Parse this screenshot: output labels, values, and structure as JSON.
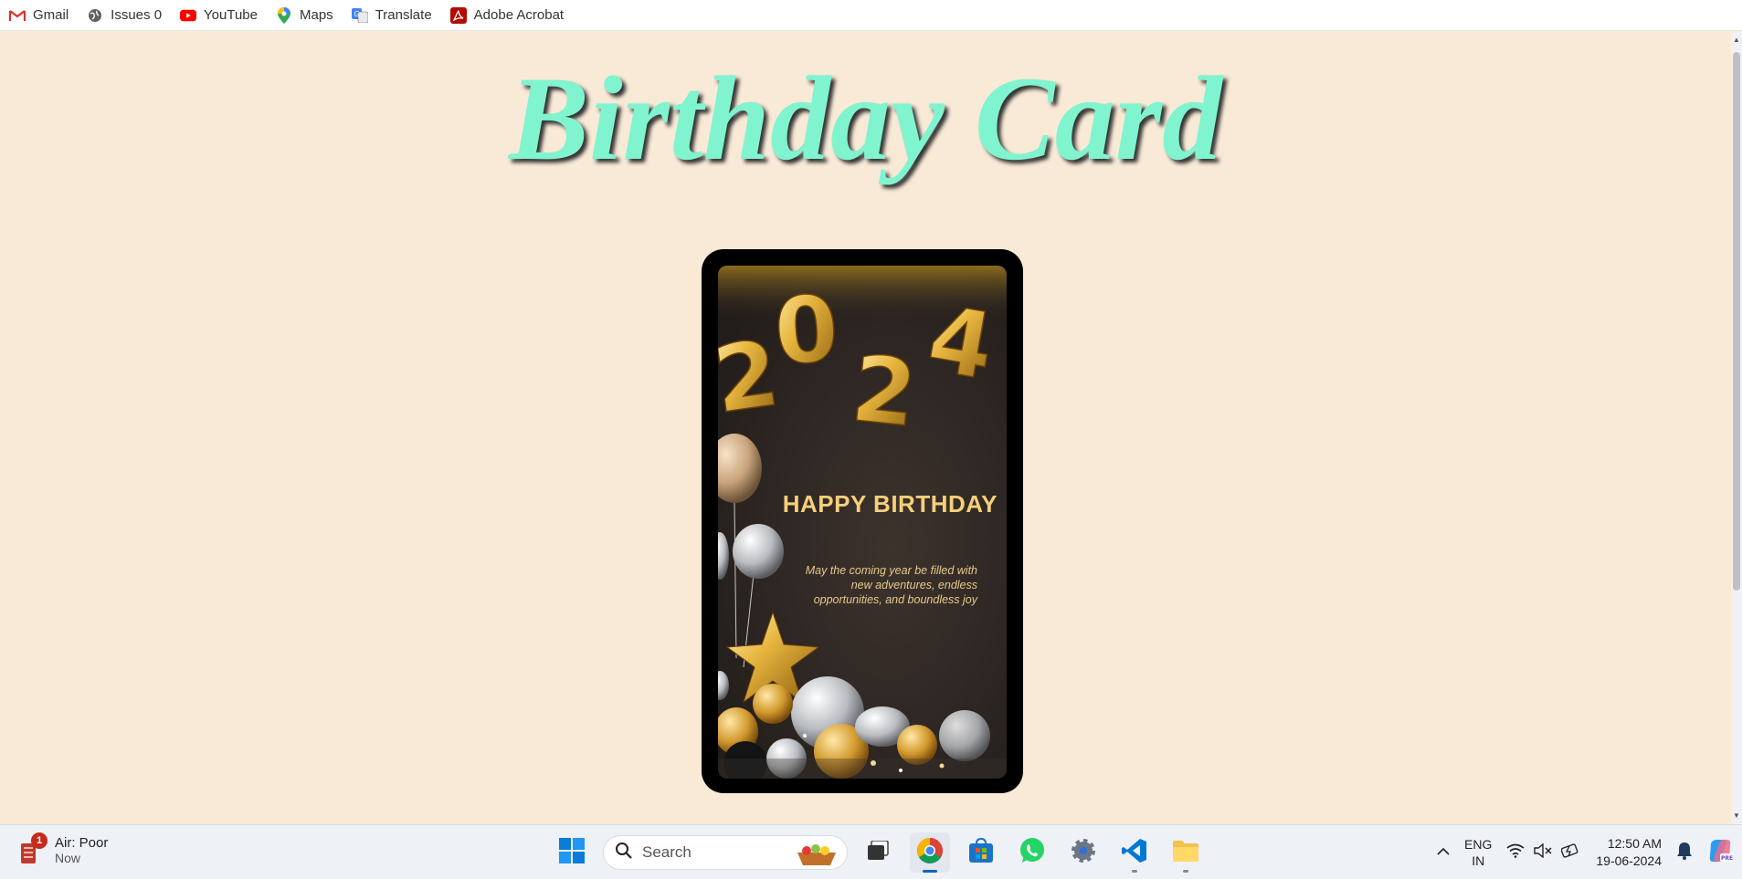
{
  "bookmarks": [
    {
      "label": "Gmail",
      "icon": "gmail-icon"
    },
    {
      "label": "Issues 0",
      "icon": "globe-icon"
    },
    {
      "label": "YouTube",
      "icon": "youtube-icon"
    },
    {
      "label": "Maps",
      "icon": "maps-icon"
    },
    {
      "label": "Translate",
      "icon": "translate-icon"
    },
    {
      "label": "Adobe Acrobat",
      "icon": "acrobat-icon"
    }
  ],
  "page": {
    "title": "Birthday Card",
    "card": {
      "year": "2024",
      "heading": "HAPPY BIRTHDAY",
      "message": "May the coming year be filled with new adventures, endless opportunities, and boundless joy"
    }
  },
  "taskbar": {
    "weather": {
      "badge": "1",
      "title": "Air: Poor",
      "subtitle": "Now"
    },
    "search_placeholder": "Search",
    "language": {
      "line1": "ENG",
      "line2": "IN"
    },
    "clock": {
      "time": "12:50 AM",
      "date": "19-06-2024"
    }
  },
  "colors": {
    "page_bg": "#f9ead7",
    "title": "#7ff4cf",
    "card_gold": "#f5cf7a",
    "accent": "#0067c0"
  }
}
